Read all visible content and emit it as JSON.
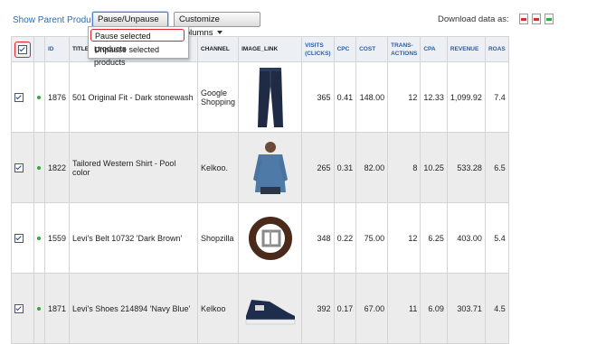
{
  "toolbar": {
    "parent_link": "Show Parent Products",
    "pause_button": "Pause/Unpause",
    "customize_button": "Customize Columns",
    "download_label": "Download data as:"
  },
  "menu": {
    "items": [
      "Pause selected products",
      "Unpause selected products"
    ]
  },
  "table": {
    "headers": {
      "id": "ID",
      "title": "TITLE",
      "channel": "CHANNEL",
      "image_link": "IMAGE_LINK",
      "visits": "VISITS (CLICKS)",
      "cpc": "CPC",
      "cost": "COST",
      "transactions": "TRANS- ACTIONS",
      "cpa": "CPA",
      "revenue": "REVENUE",
      "roas": "ROAS"
    },
    "rows": [
      {
        "id": "1876",
        "title": "501 Original Fit - Dark stonewash",
        "channel": "Google Shopping",
        "image": "jeans-image",
        "visits": "365",
        "cpc": "0.41",
        "cost": "148.00",
        "transactions": "12",
        "cpa": "12.33",
        "revenue": "1,099.92",
        "roas": "7.4"
      },
      {
        "id": "1822",
        "title": "Tailored Western Shirt - Pool color",
        "channel": "Kelkoo.",
        "image": "shirt-image",
        "visits": "265",
        "cpc": "0.31",
        "cost": "82.00",
        "transactions": "8",
        "cpa": "10.25",
        "revenue": "533.28",
        "roas": "6.5"
      },
      {
        "id": "1559",
        "title": "Levi's Belt 10732 'Dark Brown'",
        "channel": "Shopzilla",
        "image": "belt-image",
        "visits": "348",
        "cpc": "0.22",
        "cost": "75.00",
        "transactions": "12",
        "cpa": "6.25",
        "revenue": "403.00",
        "roas": "5.4"
      },
      {
        "id": "1871",
        "title": "Levi's Shoes 214894 'Navy Blue'",
        "channel": "Kelkoo",
        "image": "shoes-image",
        "visits": "392",
        "cpc": "0.17",
        "cost": "67.00",
        "transactions": "11",
        "cpa": "6.09",
        "revenue": "303.71",
        "roas": "4.5"
      }
    ]
  },
  "colors": {
    "accent": "#2b5ea8",
    "highlight": "#e0242a",
    "active_dot": "#33aa33"
  }
}
